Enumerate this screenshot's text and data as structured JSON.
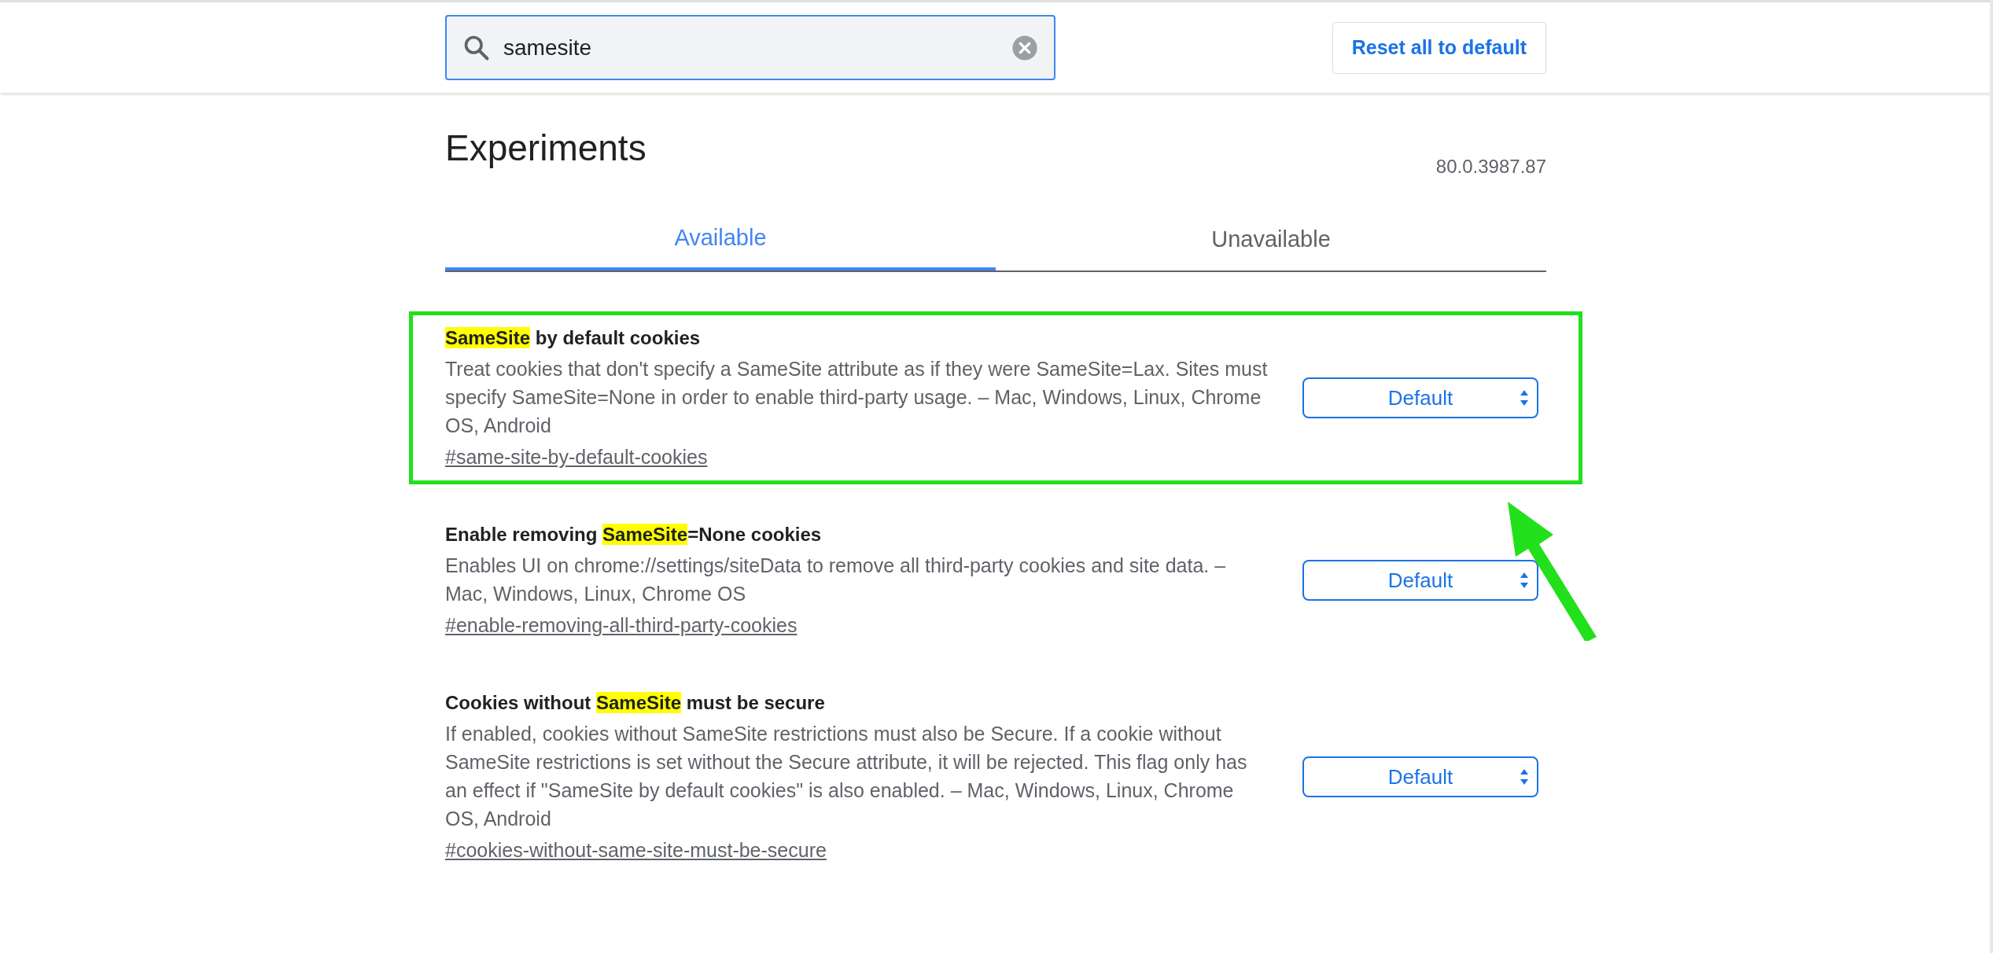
{
  "search": {
    "value": "samesite"
  },
  "reset_button": "Reset all to default",
  "title": "Experiments",
  "version": "80.0.3987.87",
  "tabs": [
    {
      "label": "Available",
      "selected": true
    },
    {
      "label": "Unavailable",
      "selected": false
    }
  ],
  "flags": [
    {
      "title": [
        {
          "text": "SameSite",
          "highlighted": true
        },
        {
          "text": " by default cookies",
          "highlighted": false
        }
      ],
      "description": "Treat cookies that don't specify a SameSite attribute as if they were SameSite=Lax. Sites must specify SameSite=None in order to enable third-party usage. – Mac, Windows, Linux, Chrome OS, Android",
      "link": "#same-site-by-default-cookies",
      "value": "Default",
      "annotated": true
    },
    {
      "title": [
        {
          "text": "Enable removing ",
          "highlighted": false
        },
        {
          "text": "SameSite",
          "highlighted": true
        },
        {
          "text": "=None cookies",
          "highlighted": false
        }
      ],
      "description": "Enables UI on chrome://settings/siteData to remove all third-party cookies and site data. – Mac, Windows, Linux, Chrome OS",
      "link": "#enable-removing-all-third-party-cookies",
      "value": "Default",
      "annotated": false
    },
    {
      "title": [
        {
          "text": "Cookies without ",
          "highlighted": false
        },
        {
          "text": "SameSite",
          "highlighted": true
        },
        {
          "text": " must be secure",
          "highlighted": false
        }
      ],
      "description": "If enabled, cookies without SameSite restrictions must also be Secure. If a cookie without SameSite restrictions is set without the Secure attribute, it will be rejected. This flag only has an effect if \"SameSite by default cookies\" is also enabled. – Mac, Windows, Linux, Chrome OS, Android",
      "link": "#cookies-without-same-site-must-be-secure",
      "value": "Default",
      "annotated": false
    }
  ]
}
